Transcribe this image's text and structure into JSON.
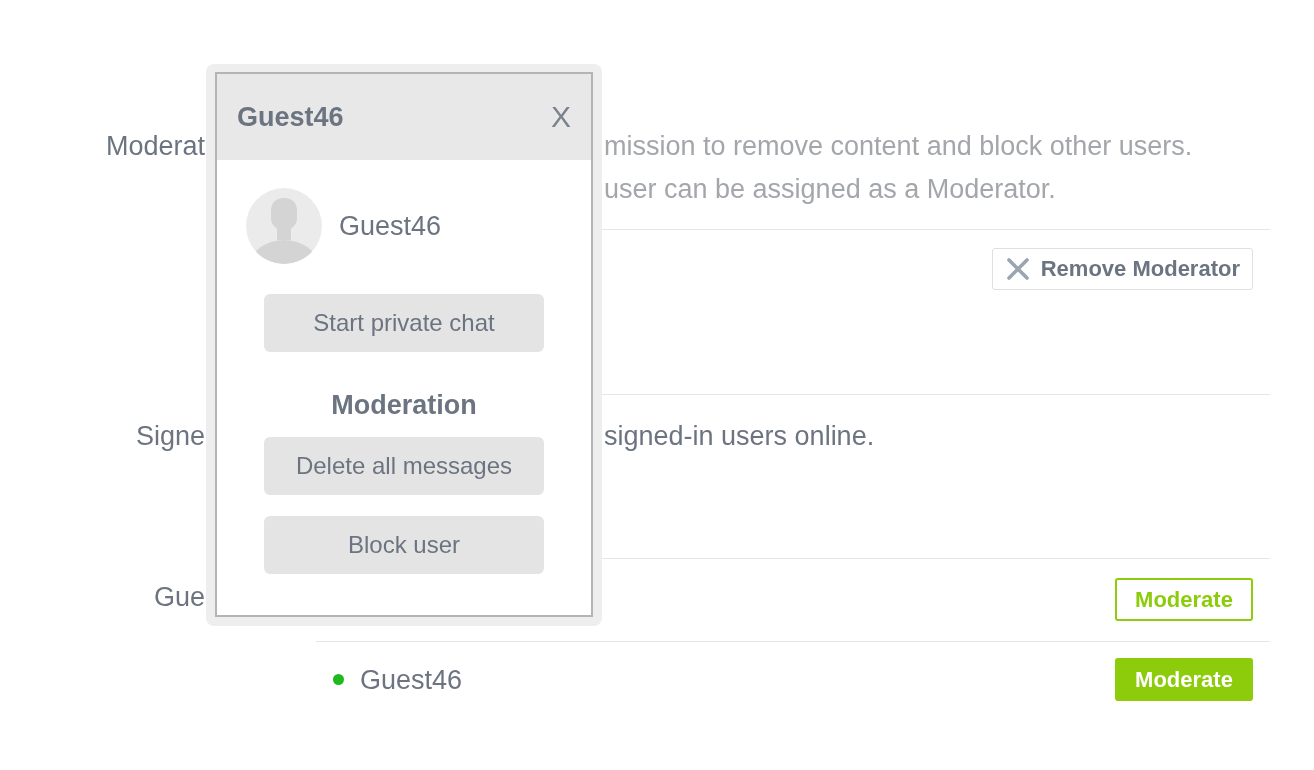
{
  "moderators": {
    "label": "Moderat",
    "description": [
      "mission to remove content and block other users.",
      "user can be assigned as a Moderator."
    ],
    "rows": [
      {
        "remove_button": "Remove Moderator"
      }
    ]
  },
  "signed_in": {
    "label": "Signe",
    "description": "signed-in users online."
  },
  "guests": {
    "label": "Gue",
    "rows": [
      {
        "moderate_button": {
          "label": "Moderate",
          "active": false
        }
      },
      {
        "name": "Guest46",
        "online": true,
        "moderate_button": {
          "label": "Moderate",
          "active": true
        }
      }
    ]
  },
  "user_popup": {
    "title": "Guest46",
    "close": "X",
    "user_name": "Guest46",
    "chat_button": "Start private chat",
    "moderation_heading": "Moderation",
    "moderation_buttons": [
      "Delete all messages",
      "Block user"
    ]
  }
}
